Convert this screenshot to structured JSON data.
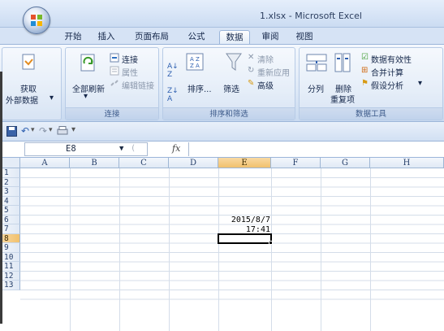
{
  "window": {
    "title": "1.xlsx - Microsoft Excel"
  },
  "tabs": [
    "开始",
    "插入",
    "页面布局",
    "公式",
    "数据",
    "审阅",
    "视图"
  ],
  "active_tab": "数据",
  "ribbon": {
    "external_data": {
      "line1": "获取",
      "line2": "外部数据"
    },
    "connections": {
      "refresh_all": "全部刷新",
      "connections": "连接",
      "properties": "属性",
      "edit_links": "编辑链接",
      "label": "连接"
    },
    "sort_filter": {
      "sort": "排序...",
      "filter": "筛选",
      "clear": "清除",
      "reapply": "重新应用",
      "advanced": "高级",
      "label": "排序和筛选"
    },
    "data_tools": {
      "text_to_columns": "分列",
      "remove_duplicates_1": "删除",
      "remove_duplicates_2": "重复项",
      "data_validation": "数据有效性",
      "consolidate": "合并计算",
      "what_if": "假设分析",
      "label": "数据工具"
    }
  },
  "formula_bar": {
    "name_box": "E8",
    "fx": "fx",
    "value": ""
  },
  "columns": [
    "A",
    "B",
    "C",
    "D",
    "E",
    "F",
    "G",
    "H"
  ],
  "selected_column": "E",
  "rows": [
    "1",
    "2",
    "3",
    "4",
    "5",
    "6",
    "7",
    "8",
    "9",
    "10",
    "11",
    "12",
    "13"
  ],
  "selected_row": "8",
  "cells": {
    "E6": "2015/8/7",
    "E7": "17:41"
  },
  "colors": {
    "accent": "#f1c16d",
    "ribbon": "#dde8f6",
    "header": "#e0e9f5"
  }
}
